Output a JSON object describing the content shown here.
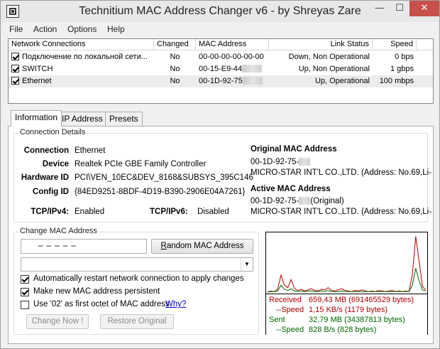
{
  "window": {
    "title": "Technitium MAC Address Changer v6 - by Shreyas Zare",
    "controls": {
      "minimize": "—",
      "maximize": "☐",
      "close": "✕"
    }
  },
  "menu": [
    "File",
    "Action",
    "Options",
    "Help"
  ],
  "network_list": {
    "columns": [
      "Network Connections",
      "Changed",
      "MAC Address",
      "Link Status",
      "Speed"
    ],
    "rows": [
      {
        "name": "Подключение по локальной сети...",
        "changed": "No",
        "mac": "00-00-00-00-00-00",
        "mac_hidden": false,
        "status": "Down, Non Operational",
        "speed": "0 bps",
        "checked": true
      },
      {
        "name": "SWITCH",
        "changed": "No",
        "mac": "00-15-E9-44",
        "mac_hidden": true,
        "status": "Up, Non Operational",
        "speed": "1 gbps",
        "checked": true
      },
      {
        "name": "Ethernet",
        "changed": "No",
        "mac": "00-1D-92-75",
        "mac_hidden": true,
        "status": "Up, Operational",
        "speed": "100 mbps",
        "checked": true
      }
    ]
  },
  "tabs": [
    "Information",
    "IP Address",
    "Presets"
  ],
  "active_tab": "Information",
  "connection_details": {
    "legend": "Connection Details",
    "connection_label": "Connection",
    "connection_value": "Ethernet",
    "device_label": "Device",
    "device_value": "Realtek PCIe GBE Family Controller",
    "hardware_id_label": "Hardware ID",
    "hardware_id_value": "PCI\\VEN_10EC&DEV_8168&SUBSYS_395C146",
    "config_id_label": "Config ID",
    "config_id_value": "{84ED9251-8BDF-4D19-B390-2906E04A7261}",
    "tcpipv4_label": "TCP/IPv4:",
    "tcpipv4_value": "Enabled",
    "tcpipv6_label": "TCP/IPv6:",
    "tcpipv6_value": "Disabled",
    "original_mac_heading": "Original MAC Address",
    "original_mac_value": "00-1D-92-75-",
    "original_vendor": "MICRO-STAR INT'L CO.,LTD.  (Address: No.69,Li-",
    "active_mac_heading": "Active MAC Address",
    "active_mac_value": "00-1D-92-75-",
    "active_mac_suffix": "(Original)",
    "active_vendor": "MICRO-STAR INT'L CO.,LTD.  (Address: No.69,Li-"
  },
  "change_mac": {
    "legend": "Change MAC Address",
    "mac_dashes": "–    –    –    –    –",
    "random_button_prefix": "R",
    "random_button_rest": "andom MAC Address",
    "dropdown_value": "",
    "options": [
      {
        "label": "Automatically restart network connection to apply changes",
        "checked": true
      },
      {
        "label": "Make new MAC address persistent",
        "checked": true
      },
      {
        "label": "Use '02' as first octet of MAC address",
        "checked": false
      }
    ],
    "why_link": "Why?",
    "change_now_button": "Change Now !",
    "restore_button": "Restore Original"
  },
  "traffic": {
    "received_label": "Received",
    "received_value": "659,43 MB (691465529 bytes)",
    "received_speed_label": "--Speed",
    "received_speed_value": "1,15 KB/s (1179 bytes)",
    "sent_label": "Sent",
    "sent_value": "32,79 MB (34387813 bytes)",
    "sent_speed_label": "--Speed",
    "sent_speed_value": "828 B/s (828 bytes)",
    "colors": {
      "received": "#b00000",
      "sent": "#006600"
    },
    "received_series": [
      0,
      0.02,
      0.01,
      0.05,
      0.3,
      0.12,
      0.08,
      0.22,
      0.06,
      0.03,
      0.05,
      0.02,
      0.04,
      0.06,
      0.03,
      0.02,
      0.05,
      0.04,
      0.08,
      0.03,
      0.02,
      0.04,
      0.06,
      0.03,
      0.02,
      0.01,
      0.03,
      0.02,
      0.04,
      0.02,
      0.01,
      0.02,
      0.01,
      0.03,
      0.02,
      0.01,
      0.02,
      0.03,
      0.01,
      0.02,
      0.01,
      0.02,
      0.01,
      0.3,
      0.98,
      0.55,
      0.1,
      0.04
    ],
    "sent_series": [
      0,
      0.01,
      0.01,
      0.02,
      0.12,
      0.05,
      0.03,
      0.06,
      0.02,
      0.01,
      0.02,
      0.01,
      0.02,
      0.02,
      0.01,
      0.01,
      0.02,
      0.01,
      0.03,
      0.01,
      0.01,
      0.01,
      0.02,
      0.01,
      0.01,
      0.01,
      0.01,
      0.01,
      0.01,
      0.01,
      0.01,
      0.01,
      0.01,
      0.01,
      0.01,
      0.01,
      0.01,
      0.01,
      0.01,
      0.01,
      0.01,
      0.01,
      0.01,
      0.12,
      0.42,
      0.2,
      0.04,
      0.02
    ]
  }
}
